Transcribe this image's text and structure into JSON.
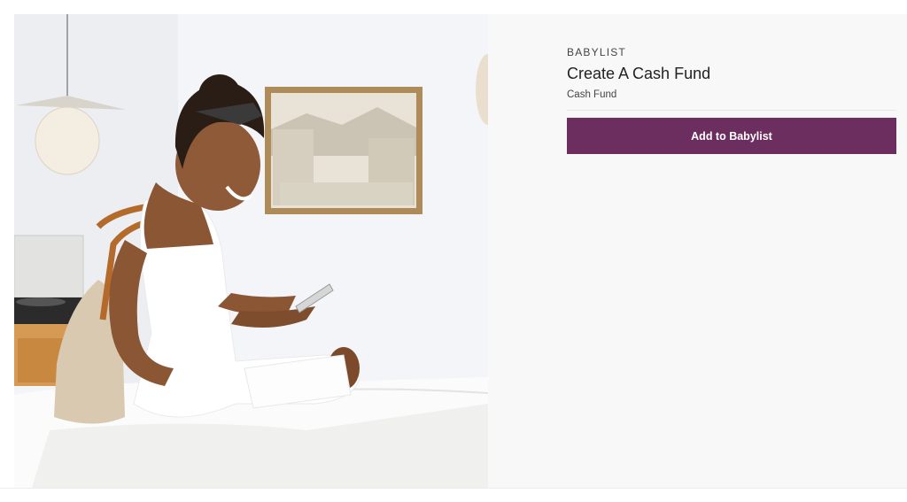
{
  "product": {
    "brand": "BABYLIST",
    "title": "Create A Cash Fund",
    "subtitle": "Cash Fund"
  },
  "actions": {
    "add_label": "Add to Babylist"
  },
  "colors": {
    "button": "#6b2e5f",
    "panel_bg": "#f8f8f8"
  },
  "image": {
    "icon": "product-photo"
  }
}
